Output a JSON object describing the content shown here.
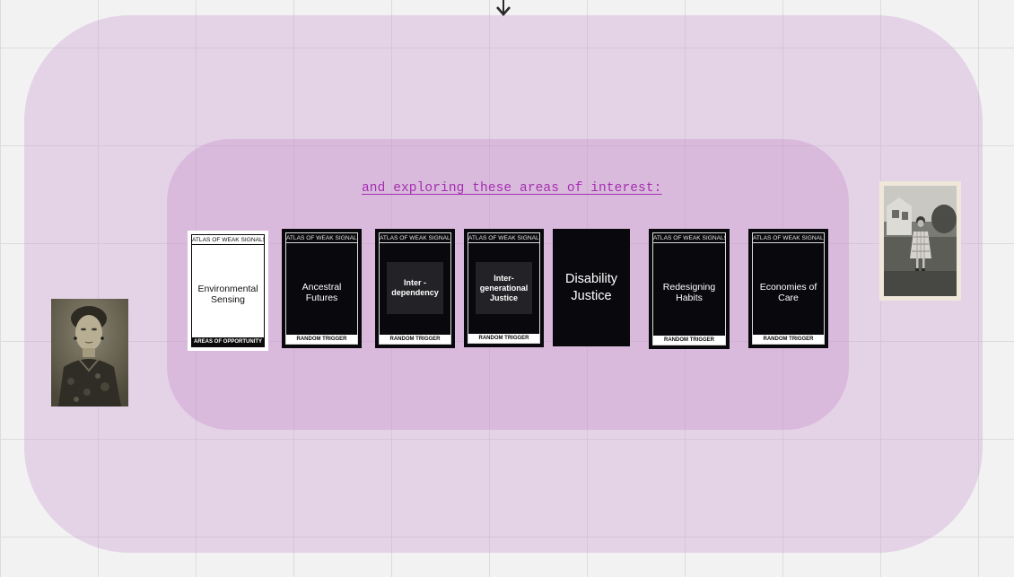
{
  "board": {
    "heading": "and exploring these areas of interest:"
  },
  "cards": [
    {
      "header": "ATLAS OF WEAK SIGNALS",
      "title": "Environmental\nSensing",
      "footer": "AREAS OF OPPORTUNITY"
    },
    {
      "header": "ATLAS OF WEAK SIGNALS",
      "title": "Ancestral\nFutures",
      "footer": "RANDOM TRIGGER"
    },
    {
      "header": "ATLAS OF WEAK SIGNALS",
      "title": "Inter -\ndependency",
      "footer": "RANDOM TRIGGER"
    },
    {
      "header": "ATLAS OF WEAK SIGNALS",
      "title": "Inter-\ngenerational\nJustice",
      "footer": "RANDOM TRIGGER"
    },
    {
      "title": "Disability\nJustice"
    },
    {
      "header": "ATLAS OF WEAK SIGNALS",
      "title": "Redesigning\nHabits",
      "footer": "RANDOM TRIGGER"
    },
    {
      "header": "ATLAS OF WEAK SIGNALS",
      "title": "Economies of\nCare",
      "footer": "RANDOM TRIGGER"
    }
  ],
  "colors": {
    "outer_frame": "#e3cde6",
    "inner_frame": "#d7b3da",
    "heading_link": "#a32fb0",
    "card_dark": "#09080c",
    "grid_line": "#dcdcdc"
  },
  "icons": {
    "connector": "arrow-down-icon"
  }
}
